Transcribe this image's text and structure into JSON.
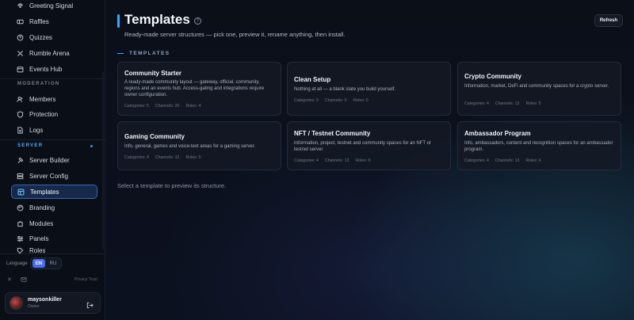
{
  "sidebar": {
    "items_top": [
      {
        "label": "Greeting Signal",
        "icon": "signal-icon"
      },
      {
        "label": "Raffles",
        "icon": "ticket-icon"
      },
      {
        "label": "Quizzes",
        "icon": "quiz-icon"
      },
      {
        "label": "Rumble Arena",
        "icon": "swords-icon"
      },
      {
        "label": "Events Hub",
        "icon": "calendar-icon"
      }
    ],
    "moderation_title": "MODERATION",
    "items_moderation": [
      {
        "label": "Members",
        "icon": "users-icon"
      },
      {
        "label": "Protection",
        "icon": "shield-icon"
      },
      {
        "label": "Logs",
        "icon": "file-icon"
      }
    ],
    "server_title": "SERVER",
    "items_server": [
      {
        "label": "Server Builder",
        "icon": "hammer-icon"
      },
      {
        "label": "Server Config",
        "icon": "config-icon"
      },
      {
        "label": "Templates",
        "icon": "template-icon"
      },
      {
        "label": "Branding",
        "icon": "palette-icon"
      },
      {
        "label": "Modules",
        "icon": "puzzle-icon"
      },
      {
        "label": "Panels",
        "icon": "sliders-icon"
      },
      {
        "label": "Roles",
        "icon": "tag-icon"
      }
    ],
    "language_label": "Language",
    "lang_en": "EN",
    "lang_ru": "RU",
    "legal": "Privacy  Trust",
    "user": {
      "name": "maysonkiller",
      "role": "Owner"
    }
  },
  "header": {
    "title": "Templates",
    "subtitle": "Ready-made server structures — pick one, preview it, rename anything, then install.",
    "refresh_label": "Refresh"
  },
  "section_label": "TEMPLATES",
  "cards": [
    {
      "title": "Community Starter",
      "desc": "A ready-made community layout — gateway, official, community, regions and an events hub. Access-gating and integrations require owner configuration.",
      "categories": "Categories: 5",
      "channels": "Channels: 20",
      "roles": "Roles: 4"
    },
    {
      "title": "Clean Setup",
      "desc": "Nothing at all — a blank slate you build yourself.",
      "categories": "Categories: 0",
      "channels": "Channels: 0",
      "roles": "Roles: 0"
    },
    {
      "title": "Crypto Community",
      "desc": "Information, market, DeFi and community spaces for a crypto server.",
      "categories": "Categories: 4",
      "channels": "Channels: 13",
      "roles": "Roles: 5"
    },
    {
      "title": "Gaming Community",
      "desc": "Info, general, games and voice-text areas for a gaming server.",
      "categories": "Categories: 4",
      "channels": "Channels: 12",
      "roles": "Roles: 5"
    },
    {
      "title": "NFT / Testnet Community",
      "desc": "Information, project, testnet and community spaces for an NFT or testnet server.",
      "categories": "Categories: 4",
      "channels": "Channels: 13",
      "roles": "Roles: 6"
    },
    {
      "title": "Ambassador Program",
      "desc": "Info, ambassadors, content and recognition spaces for an ambassador program.",
      "categories": "Categories: 4",
      "channels": "Channels: 13",
      "roles": "Roles: 4"
    }
  ],
  "hint": "Select a template to preview its structure.",
  "colors": {
    "accent": "#3aa7ff",
    "active_bg": "#16294a",
    "lang_active": "#4a6df0"
  }
}
